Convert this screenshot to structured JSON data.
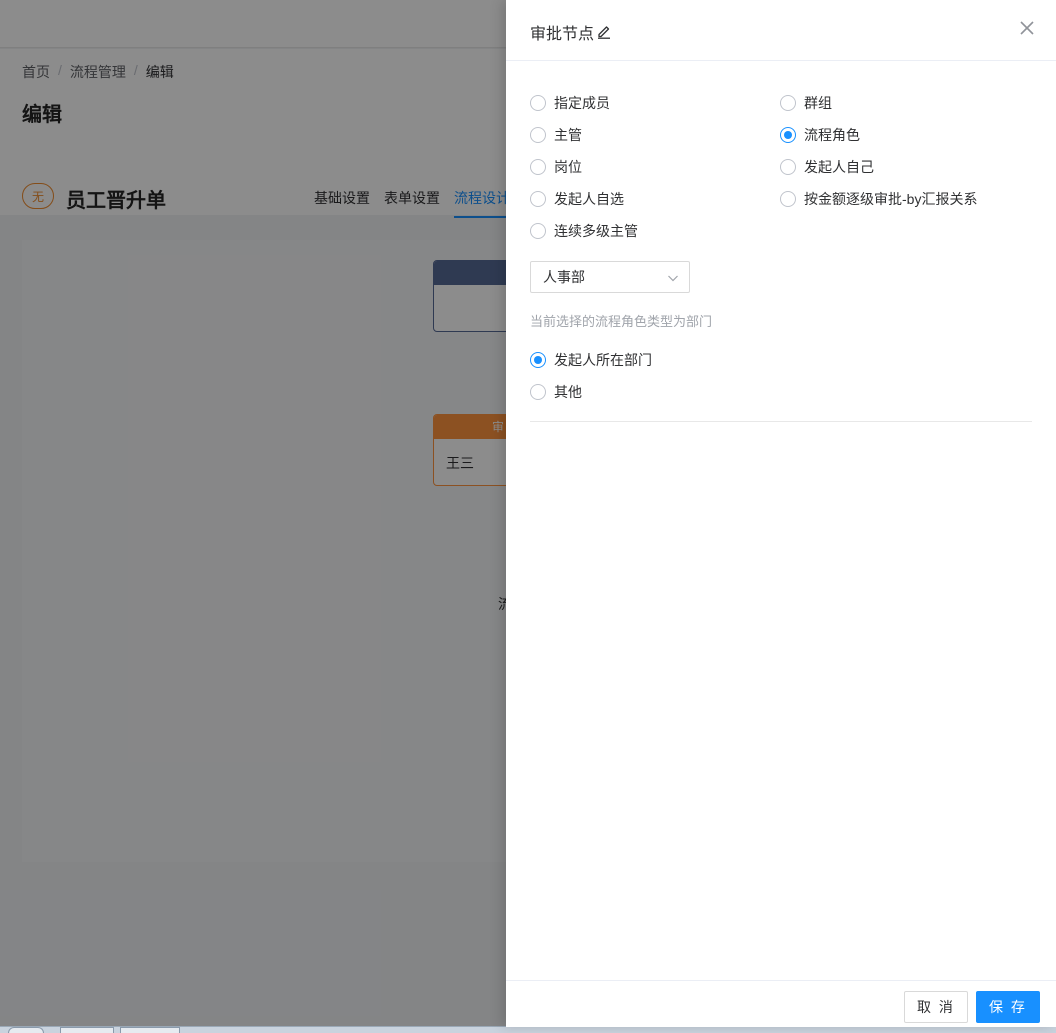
{
  "background": {
    "breadcrumb": {
      "home": "首页",
      "sep": "/",
      "flow_mgmt": "流程管理",
      "current": "编辑"
    },
    "page_title": "编辑",
    "form_badge": "无",
    "form_name": "员工晋升单",
    "tabs": [
      {
        "label": "基础设置"
      },
      {
        "label": "表单设置"
      },
      {
        "label": "流程设计"
      }
    ],
    "approve_node": {
      "header": "审",
      "body": "王三"
    },
    "canvas_text": "流"
  },
  "drawer": {
    "title": "审批节点",
    "options_left": [
      {
        "label": "指定成员",
        "checked": false
      },
      {
        "label": "主管",
        "checked": false
      },
      {
        "label": "岗位",
        "checked": false
      },
      {
        "label": "发起人自选",
        "checked": false
      },
      {
        "label": "连续多级主管",
        "checked": false
      }
    ],
    "options_right": [
      {
        "label": "群组",
        "checked": false
      },
      {
        "label": "流程角色",
        "checked": true
      },
      {
        "label": "发起人自己",
        "checked": false
      },
      {
        "label": "按金额逐级审批-by汇报关系",
        "checked": false
      }
    ],
    "role_select": {
      "value": "人事部"
    },
    "hint": "当前选择的流程角色类型为部门",
    "dept_options": [
      {
        "label": "发起人所在部门",
        "checked": true
      },
      {
        "label": "其他",
        "checked": false
      }
    ],
    "footer": {
      "cancel": "取 消",
      "save": "保 存"
    }
  },
  "colors": {
    "primary": "#1890ff",
    "approve_node": "#ff943e",
    "start_node": "#576a95"
  }
}
